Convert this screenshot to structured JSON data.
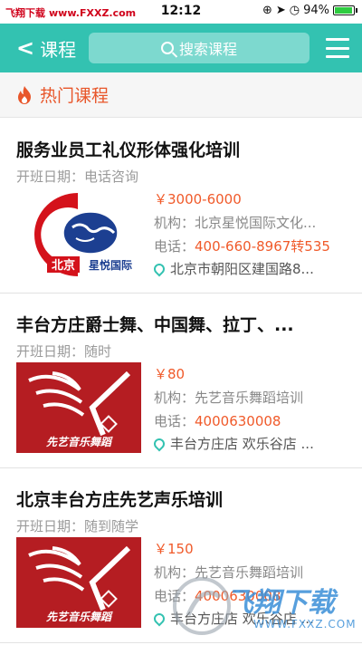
{
  "status_bar": {
    "site_name": "飞翔下载",
    "site_url": "www.FXXZ.com",
    "time": "12:12",
    "battery_text": "94%",
    "battery_level": 0.94
  },
  "header": {
    "back_label": "课程",
    "search_placeholder": "搜索课程"
  },
  "section": {
    "title": "热门课程"
  },
  "courses": [
    {
      "title": "服务业员工礼仪形体强化培训",
      "date": "开班日期：电话咨询",
      "price": "￥3000-6000",
      "org": "机构：北京星悦国际文化...",
      "phone_label": "电话：",
      "phone": "400-660-8967转535",
      "address": "北京市朝阳区建国路8...",
      "logo_left": "北京",
      "logo_right": "星悦国际"
    },
    {
      "title": "丰台方庄爵士舞、中国舞、拉丁、...",
      "date": "开班日期：随时",
      "price": "￥80",
      "org": "机构：先艺音乐舞蹈培训",
      "phone_label": "电话：",
      "phone": "4000630008",
      "address": "丰台方庄店 欢乐谷店 ...",
      "logo_text": "先艺音乐舞蹈"
    },
    {
      "title": "北京丰台方庄先艺声乐培训",
      "date": "开班日期：随到随学",
      "price": "￥150",
      "org": "机构：先艺音乐舞蹈培训",
      "phone_label": "电话：",
      "phone": "4000630008",
      "address": "丰台方庄店 欢乐谷店 ...",
      "logo_text": "先艺音乐舞蹈"
    }
  ],
  "watermark": {
    "text": "飞翔下载",
    "url": "WWW.FXXZ.COM"
  },
  "colors": {
    "header": "#33c2b1",
    "accent": "#f05a2a",
    "section_title": "#e8562a"
  }
}
